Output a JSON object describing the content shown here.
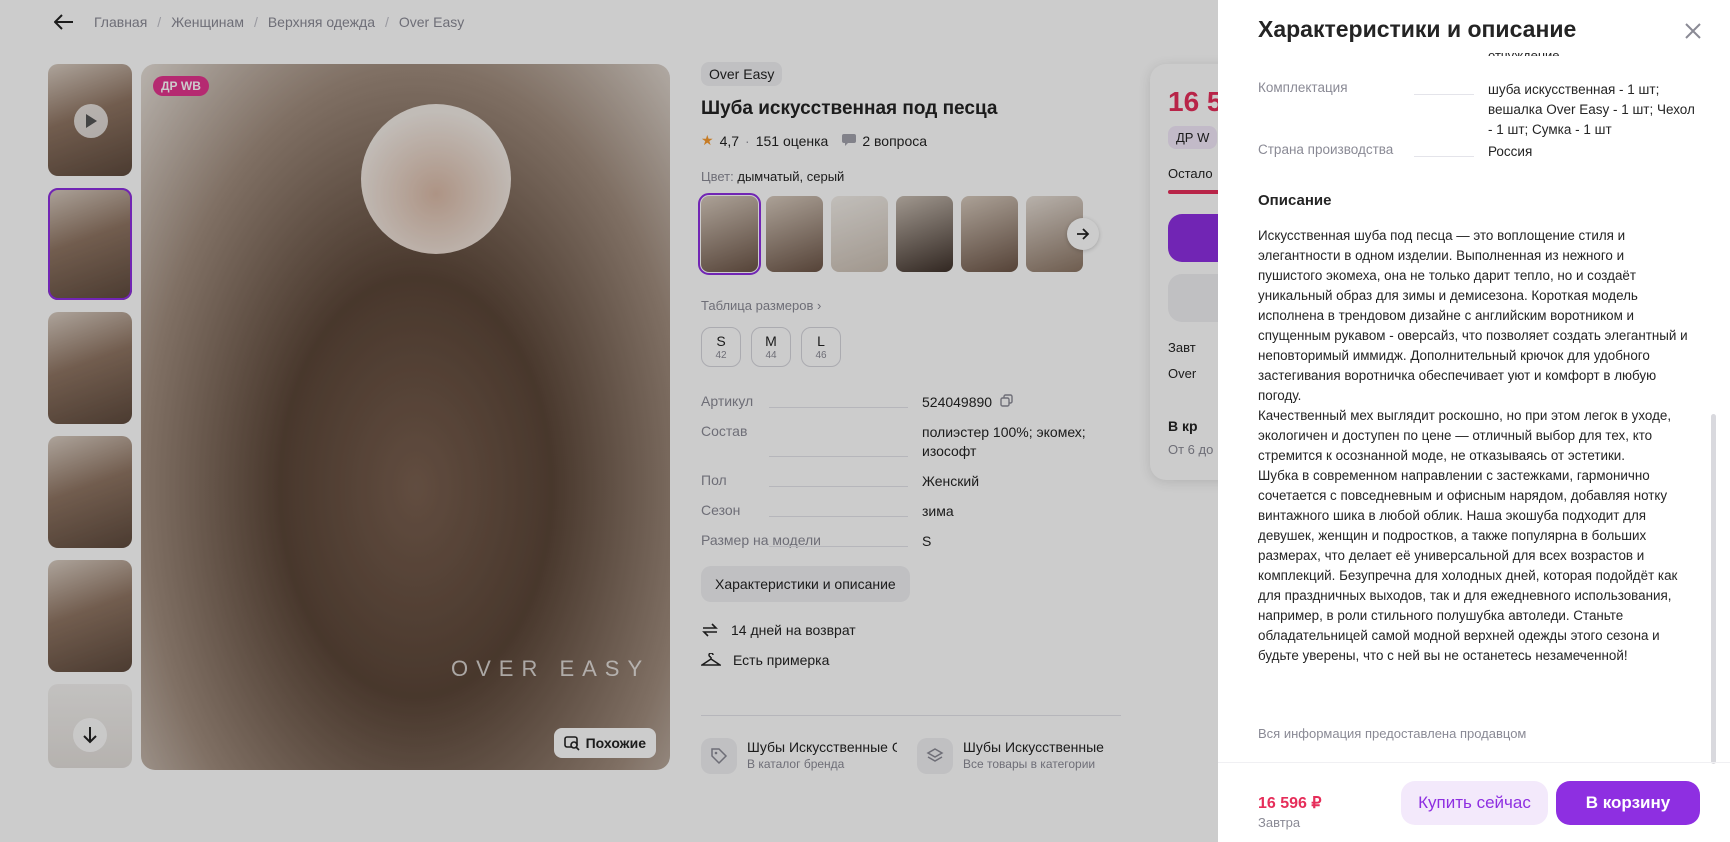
{
  "breadcrumbs": [
    "Главная",
    "Женщинам",
    "Верхняя одежда",
    "Over Easy"
  ],
  "hero": {
    "badge": "ДР WB",
    "watermark": "OVER EASY",
    "similar_label": "Похожие"
  },
  "product": {
    "brand": "Over Easy",
    "title": "Шуба искусственная под песца",
    "rating": "4,7",
    "reviews": "151 оценка",
    "questions": "2 вопроса",
    "color_label": "Цвет:",
    "color_value": "дымчатый, серый",
    "size_table_link": "Таблица размеров",
    "sizes": [
      {
        "label": "S",
        "ru": "42"
      },
      {
        "label": "M",
        "ru": "44"
      },
      {
        "label": "L",
        "ru": "46"
      }
    ],
    "attributes": [
      {
        "key": "Артикул",
        "value": "524049890"
      },
      {
        "key": "Состав",
        "value": "полиэстер 100%; экомех; изософт"
      },
      {
        "key": "Пол",
        "value": "Женский"
      },
      {
        "key": "Сезон",
        "value": "зима"
      },
      {
        "key": "Размер на модели",
        "value": "S"
      }
    ],
    "chars_button": "Характеристики и описание",
    "perks": [
      "14 дней на возврат",
      "Есть примерка"
    ],
    "categories": [
      {
        "title": "Шубы Искусственные Ove",
        "sub": "В каталог бренда"
      },
      {
        "title": "Шубы Искусственные",
        "sub": "Все товары в категории"
      }
    ]
  },
  "buybox": {
    "price_partial": "16 5",
    "tag_partial": "ДР W",
    "left_partial": "Остало",
    "row1_partial": "Завт",
    "row2_partial": "Over",
    "inbox_partial": "В кр",
    "from_partial": "От 6 до"
  },
  "drawer": {
    "title": "Характеристики и описание",
    "cut_text": "отчуждение",
    "rows": [
      {
        "key": "Комплектация",
        "value": "шуба искусственная - 1 шт; вешалка Over Easy - 1 шт; Чехол - 1 шт; Сумка - 1 шт"
      },
      {
        "key": "Страна производства",
        "value": "Россия"
      }
    ],
    "desc_heading": "Описание",
    "description": [
      "Искусственная шуба под песца — это воплощение стиля и элегантности в одном изделии. Выполненная из нежного и пушистого экомеха, она не только дарит тепло, но и создаёт уникальный образ для зимы и демисезона. Короткая модель исполнена в трендовом дизайне с английским воротником и спущенным рукавом - оверсайз, что позволяет создать элегантный и неповторимый иммидж. Дополнительный крючок для удобного застегивания воротничка обеспечивает уют и комфорт в любую погоду.",
      "Качественный мех выглядит роскошно, но при этом легок в уходе, экологичен и доступен по цене — отличный выбор для тех, кто стремится к осознанной моде, не отказываясь от эстетики.",
      "Шубка в современном направлении с застежками, гармонично сочетается с повседневным и офисным нарядом, добавляя нотку винтажного шика в любой облик. Наша экошуба подходит для девушек, женщин и подростков, а также популярна в больших размерах, что делает её универсальной для всех возрастов и комплекций. Безупречна для холодных дней, которая подойдёт как для праздничных выходов, так и для ежедневного использования, например, в роли стильного полушубка автоледи. Станьте обладательницей самой модной верхней одежды этого сезона и будьте уверены, что с ней вы не останетесь незамеченной!"
    ],
    "seller_note": "Вся информация предоставлена продавцом",
    "footer": {
      "price": "16 596 ₽",
      "date": "Завтра",
      "buy_now": "Купить сейчас",
      "to_cart": "В корзину"
    }
  },
  "colors": {
    "accent": "#8e2fe1",
    "price": "#e62e5a",
    "badge": "#e3358e"
  }
}
